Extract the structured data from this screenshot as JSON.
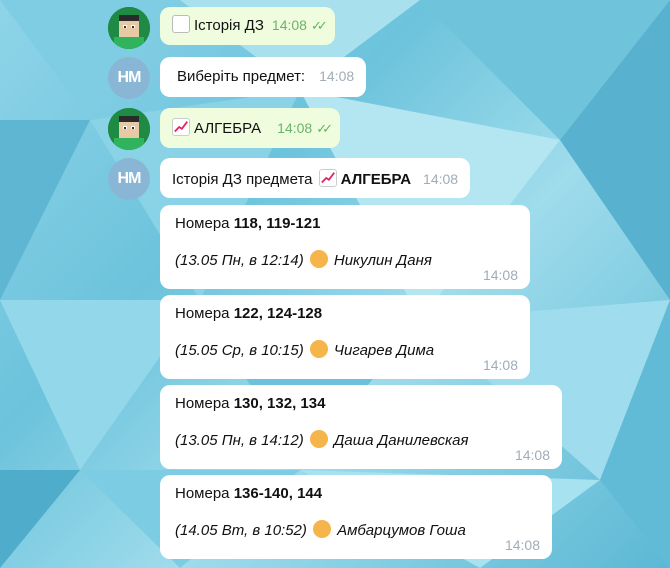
{
  "messages": [
    {
      "type": "out",
      "emoji": "notepad-icon",
      "text": "Історія ДЗ",
      "time": "14:08"
    },
    {
      "type": "in",
      "text": "Виберіть предмет:",
      "time": "14:08"
    },
    {
      "type": "out",
      "emoji": "chart-icon",
      "text": "АЛГЕБРА",
      "time": "14:08"
    },
    {
      "type": "in",
      "text_prefix": "Історія ДЗ предмета",
      "text_bold": "АЛГЕБРА",
      "time": "14:08"
    }
  ],
  "bot_avatar_text": "НМ",
  "homework": [
    {
      "prefix": "Номера",
      "numbers": "118, 119-121",
      "meta": "(13.05  Пн, в 12:14)",
      "author": "Никулин Даня",
      "time": "14:08"
    },
    {
      "prefix": "Номера",
      "numbers": "122, 124-128",
      "meta": "(15.05  Ср, в 10:15)",
      "author": "Чигарев Дима",
      "time": "14:08"
    },
    {
      "prefix": "Номера",
      "numbers": "130, 132, 134",
      "meta": "(13.05  Пн, в 14:12)",
      "author": "Даша Данилевская",
      "time": "14:08"
    },
    {
      "prefix": "Номера",
      "numbers": "136-140, 144",
      "meta": "(14.05  Вт, в 10:52)",
      "author": "Амбарцумов Гоша",
      "time": "14:08"
    }
  ],
  "colors": {
    "outgoing": "#effdde",
    "incoming": "#ffffff",
    "check": "#5fb75c"
  }
}
